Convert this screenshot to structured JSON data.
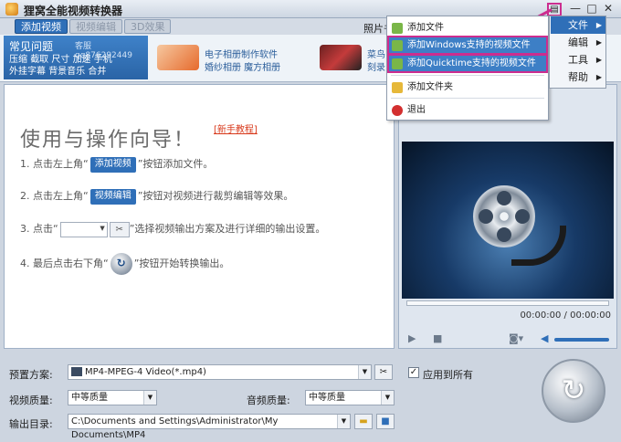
{
  "window": {
    "title": "狸窝全能视频转换器",
    "menu_icon": "menu-icon",
    "controls": [
      "—",
      "□",
      "✕"
    ]
  },
  "toolbar": {
    "add_video": "添加视频",
    "video_edit": "视频编辑",
    "effect_3d": "3D效果",
    "photo_label": "照片书"
  },
  "faq": {
    "title": "常见问题",
    "qq": "客服qq876292449",
    "links": [
      "压缩",
      "截取",
      "尺寸",
      "加速",
      "手机",
      "外挂字幕",
      "背景音乐",
      "合并"
    ]
  },
  "ads": [
    {
      "line1": "电子相册制作软件",
      "line2": "婚纱相册 魔方相册"
    },
    {
      "line1": "菜鸟",
      "line2": "刻录"
    }
  ],
  "guide": {
    "title": "使用与操作向导！",
    "tutorial_link": "[新手教程]",
    "step1_pre": "1. 点击左上角“",
    "step1_btn": "添加视频",
    "step1_post": "”按钮添加文件。",
    "step2_pre": "2. 点击左上角“",
    "step2_btn": "视频编辑",
    "step2_post": "”按钮对视频进行裁剪编辑等效果。",
    "step3_pre": "3. 点击“",
    "step3_post": "”选择视频输出方案及进行详细的输出设置。",
    "step4_pre": "4. 最后点击右下角“",
    "step4_post": "”按钮开始转换输出。"
  },
  "player": {
    "time": "00:00:00 / 00:00:00"
  },
  "settings": {
    "preset_label": "预置方案:",
    "preset_value": "MP4-MPEG-4 Video(*.mp4)",
    "apply_all_label": "应用到所有",
    "apply_all_checked": true,
    "video_quality_label": "视频质量:",
    "video_quality_value": "中等质量",
    "audio_quality_label": "音频质量:",
    "audio_quality_value": "中等质量",
    "output_label": "输出目录:",
    "output_value": "C:\\Documents and Settings\\Administrator\\My Documents\\MP4"
  },
  "context_menu": {
    "items": [
      {
        "label": "添加文件",
        "icon": "add-file-icon"
      },
      {
        "label": "添加Windows支持的视频文件",
        "icon": "add-file-icon",
        "selected": true
      },
      {
        "label": "添加Quicktime支持的视频文件",
        "icon": "add-file-icon",
        "selected": true
      },
      {
        "label": "添加文件夹",
        "icon": "folder-icon"
      },
      {
        "label": "退出",
        "icon": "exit-icon"
      }
    ]
  },
  "submenu": {
    "items": [
      {
        "label": "文件",
        "selected": true
      },
      {
        "label": "编辑",
        "selected": false
      },
      {
        "label": "工具",
        "selected": false
      },
      {
        "label": "帮助",
        "selected": false
      }
    ]
  },
  "colors": {
    "accent": "#2f6fb8",
    "highlight": "#cc2d8f",
    "link_red": "#d83a1c"
  }
}
